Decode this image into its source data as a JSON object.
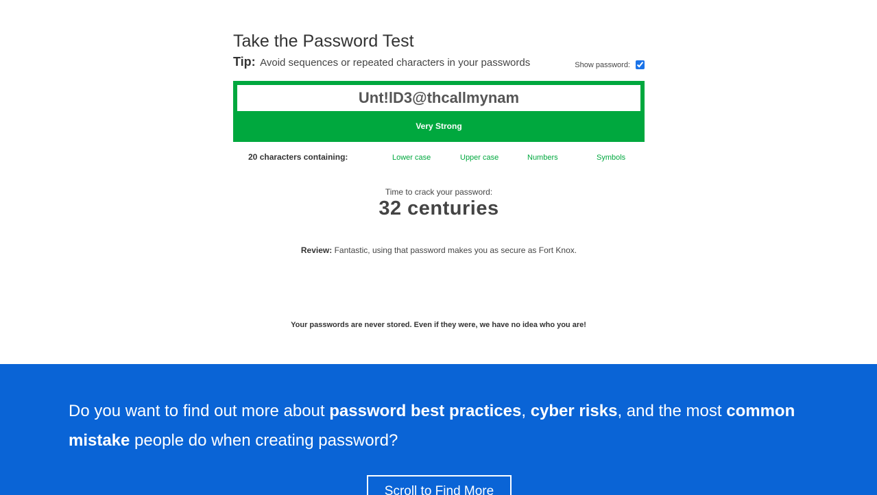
{
  "test": {
    "title": "Take the Password Test",
    "tip_label": "Tip:",
    "tip_text": "Avoid sequences or repeated characters in your passwords",
    "show_password_label": "Show password:",
    "show_password_checked": true,
    "password_value": "Unt!lD3@thcallmynam",
    "strength": "Very Strong",
    "strength_color": "#00a83e",
    "char_count": "20",
    "char_count_suffix": "characters containing:",
    "char_types": [
      "Lower case",
      "Upper case",
      "Numbers",
      "Symbols"
    ],
    "crack_label": "Time to crack your password:",
    "crack_value": "32 centuries",
    "review_label": "Review:",
    "review_text": "Fantastic, using that password makes you as secure as Fort Knox.",
    "disclaimer": "Your passwords are never stored. Even if they were, we have no idea who you are!"
  },
  "promo": {
    "text_1": "Do you want to find out more about ",
    "bold_1": "password best practices",
    "text_2": ", ",
    "bold_2": "cyber risks",
    "text_3": ", and the most ",
    "bold_3": "common mistake",
    "text_4": " people do when creating password?",
    "button_label": "Scroll to Find More",
    "background_color": "#0a64d6"
  }
}
